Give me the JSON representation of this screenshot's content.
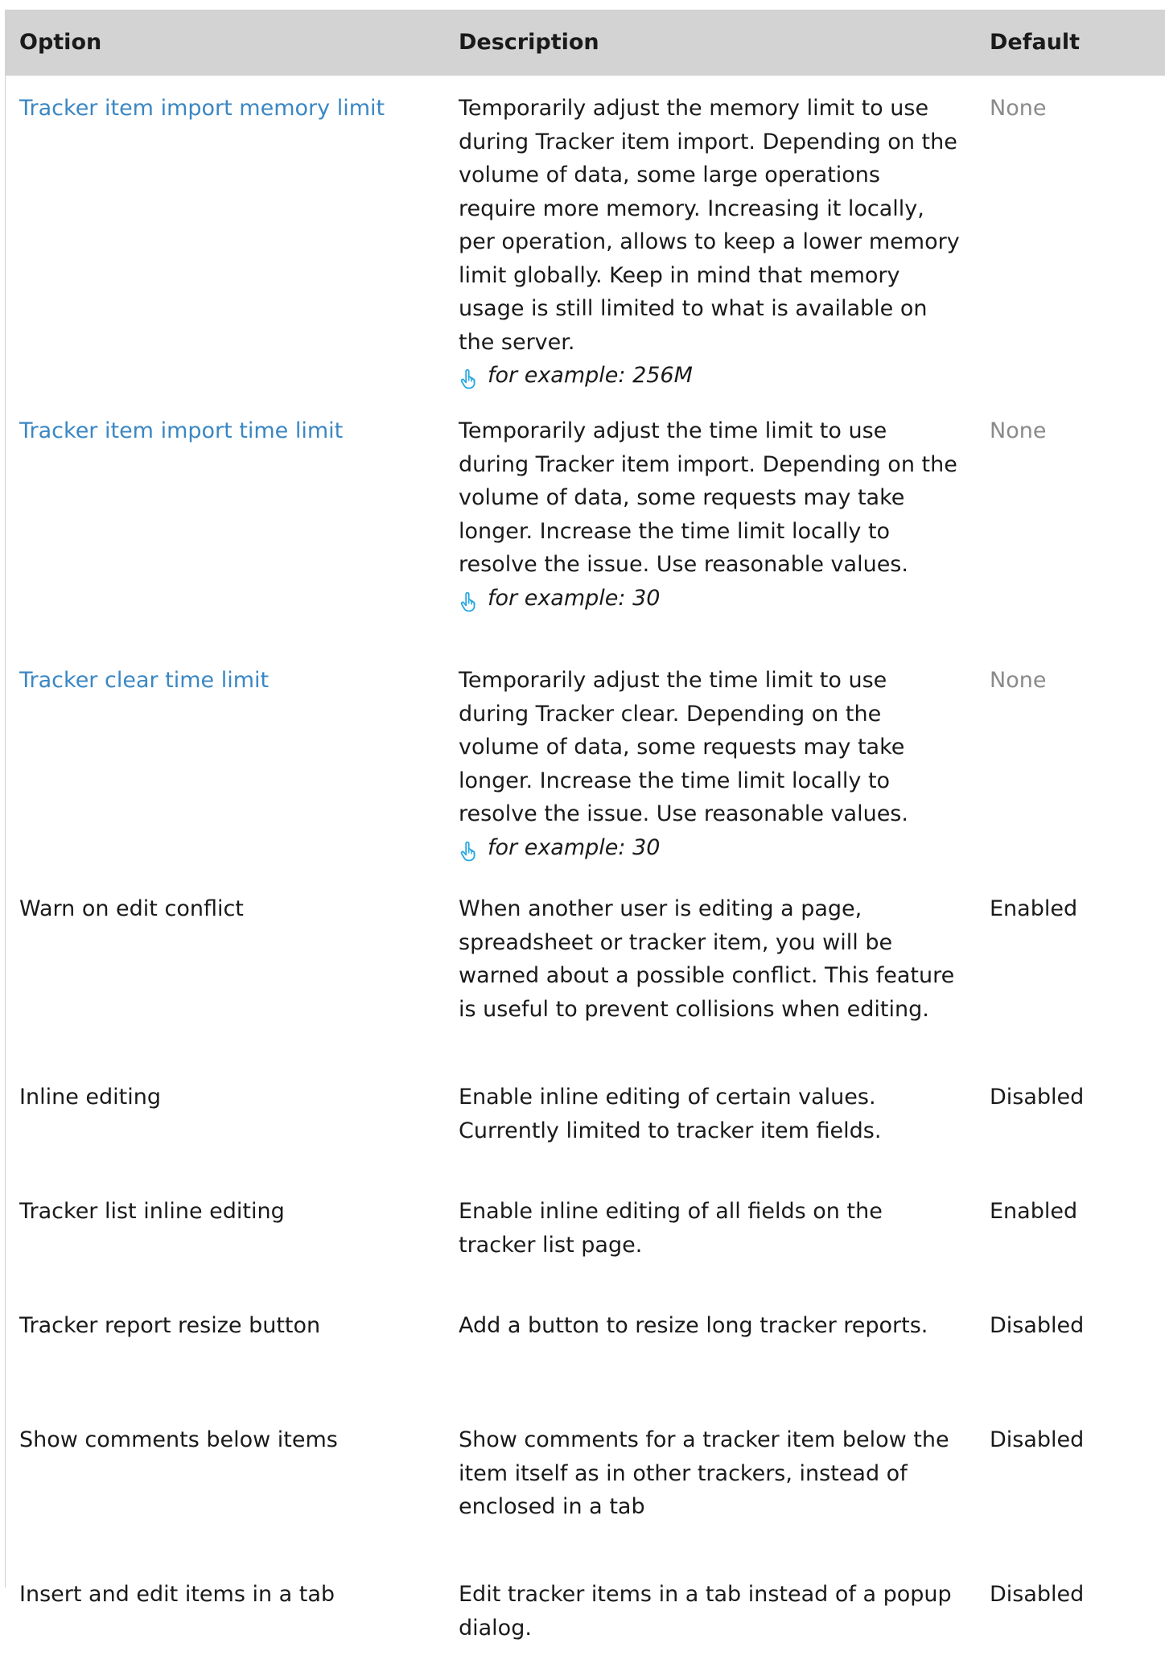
{
  "table": {
    "headers": {
      "option": "Option",
      "description": "Description",
      "default": "Default"
    },
    "rows": [
      {
        "option": "Tracker item import memory limit",
        "is_link": true,
        "description": "Temporarily adjust the memory limit to use during Tracker item import. Depending on the volume of data, some large operations require more memory. Increasing it locally, per operation, allows to keep a lower memory limit globally. Keep in mind that memory usage is still limited to what is available on the server.",
        "example": "for example: 256M",
        "default": "None",
        "default_muted": true
      },
      {
        "option": "Tracker item import time limit",
        "is_link": true,
        "description": "Temporarily adjust the time limit to use during Tracker item import. Depending on the volume of data, some requests may take longer. Increase the time limit locally to resolve the issue. Use reasonable values.",
        "example": "for example: 30",
        "default": "None",
        "default_muted": true
      },
      {
        "option": "Tracker clear time limit",
        "is_link": true,
        "description": "Temporarily adjust the time limit to use during Tracker clear. Depending on the volume of data, some requests may take longer. Increase the time limit locally to resolve the issue. Use reasonable values.",
        "example": "for example: 30",
        "default": "None",
        "default_muted": true
      },
      {
        "option": "Warn on edit conflict",
        "is_link": false,
        "description": "When another user is editing a page, spreadsheet or tracker item, you will be warned about a possible conflict. This feature is useful to prevent collisions when editing.",
        "default": "Enabled"
      },
      {
        "option": "Inline editing",
        "is_link": false,
        "description": "Enable inline editing of certain values. Currently limited to tracker item fields.",
        "default": "Disabled"
      },
      {
        "option": "Tracker list inline editing",
        "is_link": false,
        "description": "Enable inline editing of all fields on the tracker list page.",
        "default": "Enabled"
      },
      {
        "option": "Tracker report resize button",
        "is_link": false,
        "description": "Add a button to resize long tracker reports.",
        "default": "Disabled"
      },
      {
        "option": "Show comments below items",
        "is_link": false,
        "description": "Show comments for a tracker item below the item itself as in other trackers, instead of enclosed in a tab",
        "default": "Disabled"
      },
      {
        "option": "Insert and edit items in a tab",
        "is_link": false,
        "description": "Edit tracker items in a tab instead of a popup dialog.",
        "default": "Disabled"
      }
    ]
  },
  "icons": {
    "example": "pointing-hand-icon"
  },
  "colors": {
    "header_bg": "#d3d3d3",
    "link": "#3b87c3",
    "muted": "#8a8a8a",
    "icon": "#29a8e0"
  }
}
